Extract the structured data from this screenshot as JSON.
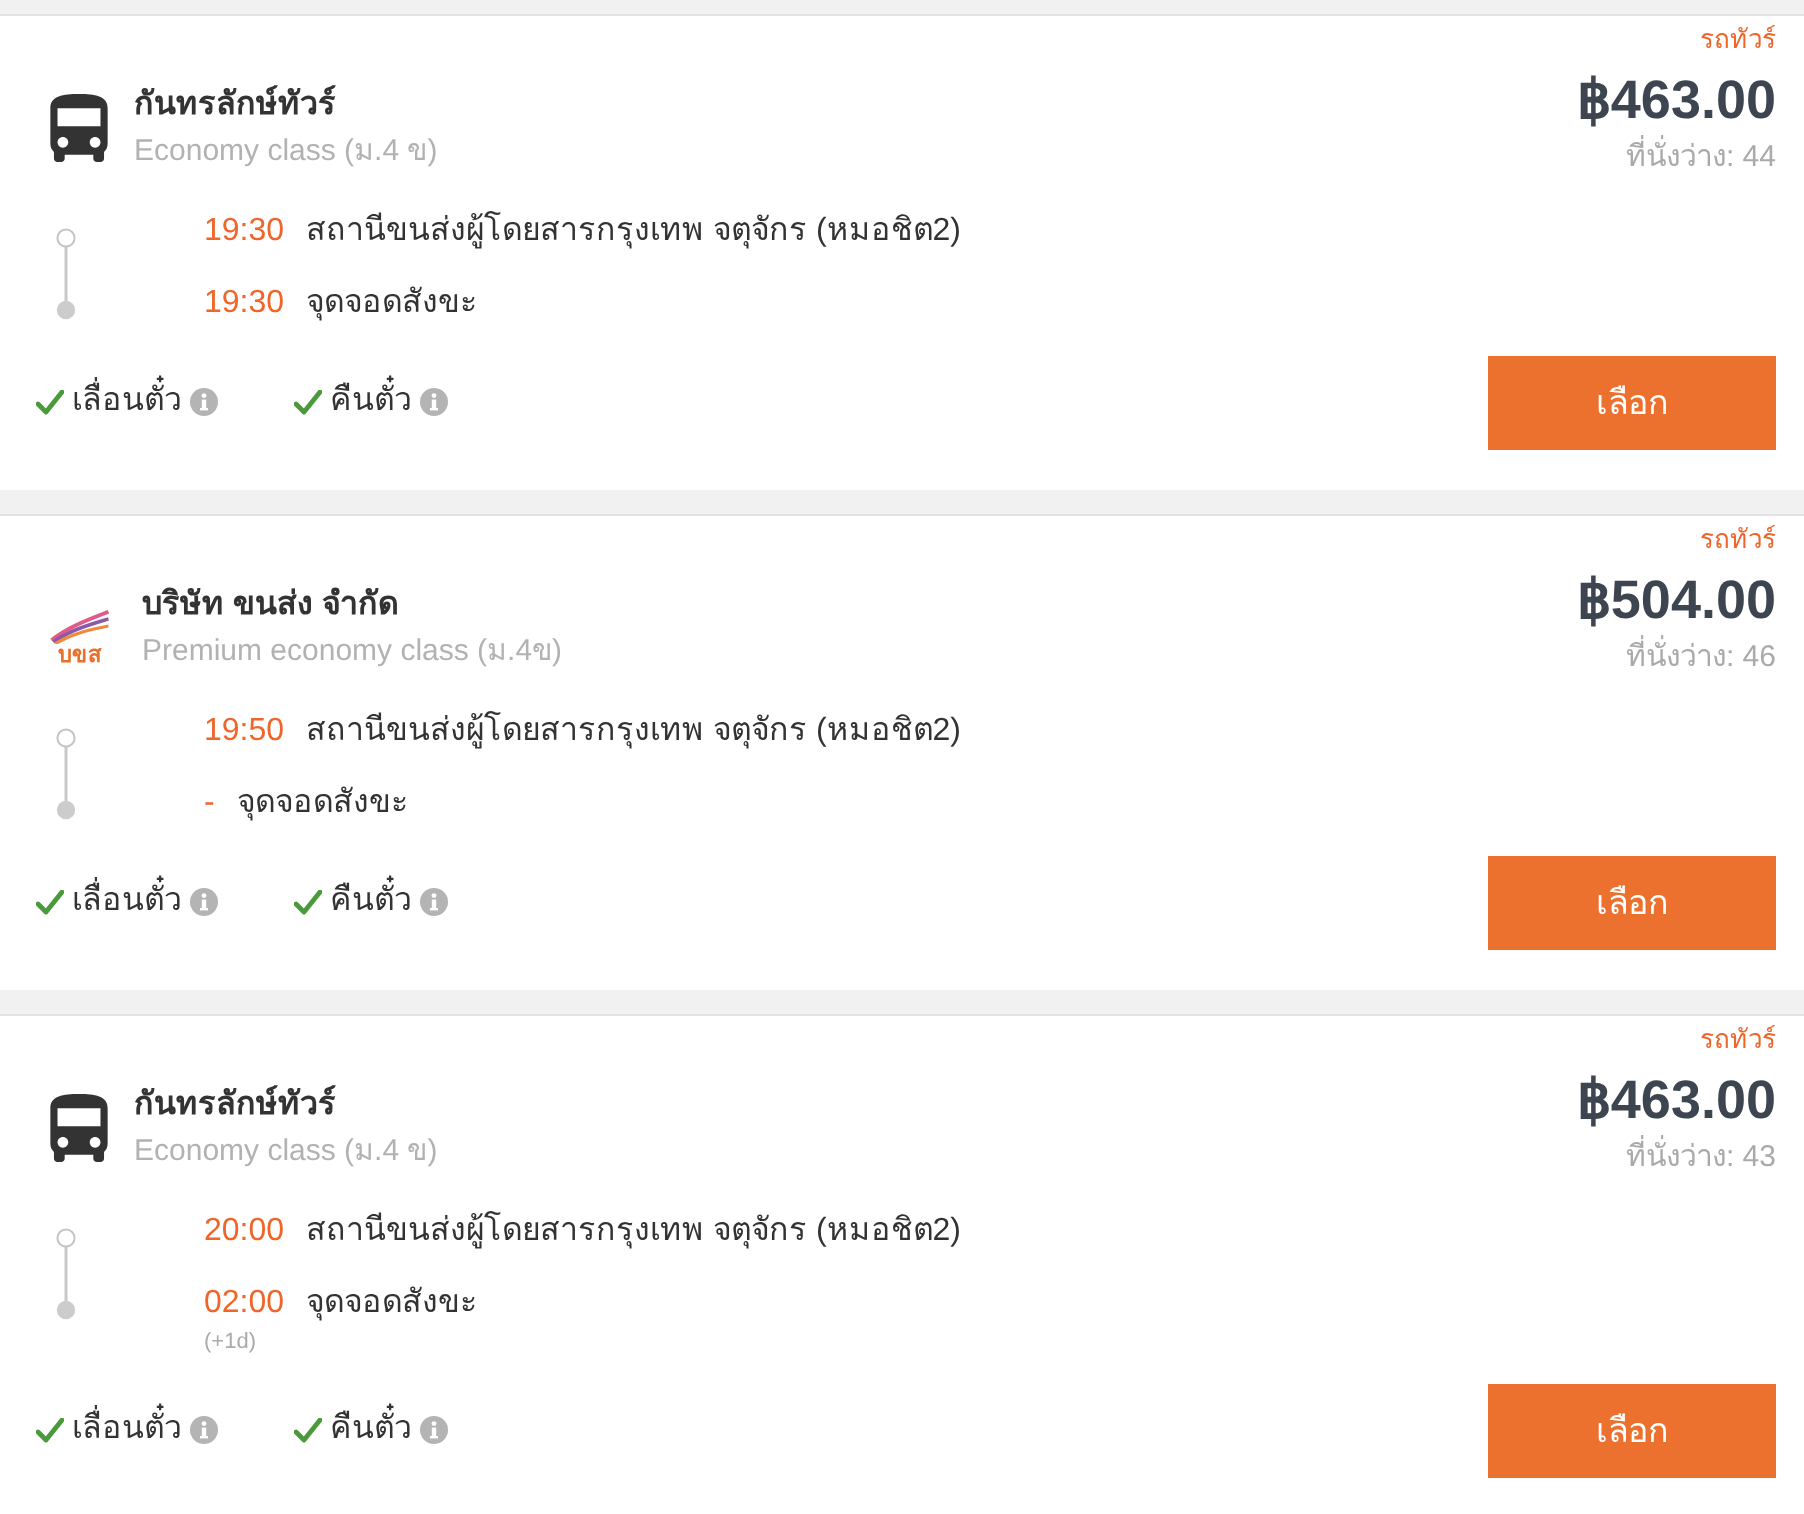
{
  "trips": [
    {
      "tag": "รถทัวร์",
      "operator": {
        "name": "กันทรลักษ์ทัวร์",
        "logo": {
          "kind": "bus"
        }
      },
      "bus_class": "Economy class (ม.4 ข)",
      "price": "฿463.00",
      "seats": "ที่นั่งว่าง: 44",
      "stops": [
        {
          "time": "19:30",
          "place": "สถานีขนส่งผู้โดยสารกรุงเทพ จตุจักร (หมอชิต2)"
        },
        {
          "time": "19:30",
          "place": "จุดจอดสังขะ"
        }
      ],
      "features": [
        {
          "label": "เลื่อนตั๋ว",
          "available": true
        },
        {
          "label": "คืนตั๋ว",
          "available": true
        }
      ],
      "button": "เลือก"
    },
    {
      "tag": "รถทัวร์",
      "operator": {
        "name": "บริษัท ขนส่ง จำกัด",
        "logo": {
          "kind": "emblem",
          "text": "บขส"
        }
      },
      "bus_class": "Premium economy class (ม.4ข)",
      "price": "฿504.00",
      "seats": "ที่นั่งว่าง: 46",
      "stops": [
        {
          "time": "19:50",
          "place": "สถานีขนส่งผู้โดยสารกรุงเทพ จตุจักร (หมอชิต2)"
        },
        {
          "time": "-",
          "place": "จุดจอดสังขะ"
        }
      ],
      "features": [
        {
          "label": "เลื่อนตั๋ว",
          "available": true
        },
        {
          "label": "คืนตั๋ว",
          "available": true
        }
      ],
      "button": "เลือก"
    },
    {
      "tag": "รถทัวร์",
      "operator": {
        "name": "กันทรลักษ์ทัวร์",
        "logo": {
          "kind": "bus"
        }
      },
      "bus_class": "Economy class (ม.4 ข)",
      "price": "฿463.00",
      "seats": "ที่นั่งว่าง: 43",
      "stops": [
        {
          "time": "20:00",
          "place": "สถานีขนส่งผู้โดยสารกรุงเทพ จตุจักร (หมอชิต2)"
        },
        {
          "time": "02:00",
          "day_offset": "(+1d)",
          "place": "จุดจอดสังขะ"
        }
      ],
      "features": [
        {
          "label": "เลื่อนตั๋ว",
          "available": true
        },
        {
          "label": "คืนตั๋ว",
          "available": true
        }
      ],
      "button": "เลือก"
    }
  ]
}
